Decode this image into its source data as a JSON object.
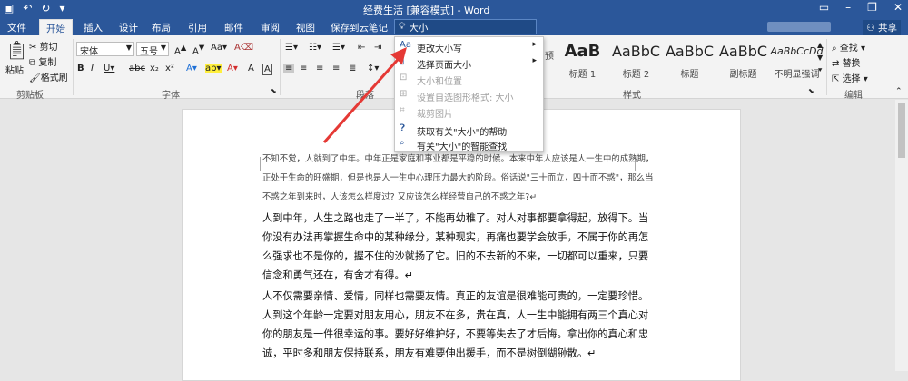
{
  "titlebar": {
    "title": "经费生活 [兼容模式] - Word",
    "share": "共享"
  },
  "tabs": [
    "文件",
    "开始",
    "插入",
    "设计",
    "布局",
    "引用",
    "邮件",
    "审阅",
    "视图",
    "保存到云笔记"
  ],
  "tell_me": {
    "value": "大小"
  },
  "clipboard": {
    "paste": "粘贴",
    "cut": "剪切",
    "copy": "复制",
    "format_painter": "格式刷",
    "label": "剪贴板"
  },
  "font": {
    "name": "宋体",
    "size": "五号",
    "label": "字体",
    "buttons": [
      "A",
      "A",
      "Aa",
      "⬚",
      "B",
      "I",
      "U",
      "abc",
      "x₂",
      "x²",
      "A",
      "ab",
      "A",
      "A"
    ]
  },
  "paragraph": {
    "label": "段落"
  },
  "styles": {
    "items": [
      {
        "preview": "AaB",
        "name": "标题 1"
      },
      {
        "preview": "AaBbC",
        "name": "标题 2"
      },
      {
        "preview": "AaBbC",
        "name": "标题"
      },
      {
        "preview": "AaBbC",
        "name": "副标题"
      },
      {
        "preview": "AaBbCcDd",
        "name": "不明显强调"
      }
    ],
    "label": "样式",
    "partial_label": "预"
  },
  "editing": {
    "find": "查找",
    "replace": "替换",
    "select": "选择",
    "label": "编辑"
  },
  "menu": {
    "items": [
      {
        "label": "更改大小写",
        "disabled": false,
        "submenu": true,
        "icon": "Aa"
      },
      {
        "label": "选择页面大小",
        "disabled": false,
        "submenu": true,
        "icon": "page-size-icon"
      },
      {
        "label": "大小和位置",
        "disabled": true,
        "submenu": false,
        "icon": "size-position-icon"
      },
      {
        "label": "设置自选图形格式: 大小",
        "disabled": true,
        "submenu": false,
        "icon": "format-shape-icon"
      },
      {
        "label": "裁剪图片",
        "disabled": true,
        "submenu": false,
        "icon": "crop-icon"
      },
      {
        "label": "获取有关\"大小\"的帮助",
        "disabled": false,
        "submenu": false,
        "icon": "help-icon"
      },
      {
        "label": "有关\"大小\"的智能查找",
        "disabled": false,
        "submenu": false,
        "icon": "smart-lookup-icon"
      }
    ]
  },
  "document": {
    "p1": "不知不觉，人就到了中年。中年正是家庭和事业都是平稳的时候。本来中年人应该是人一生中的成熟期，正处于生命的旺盛期，但是也是人一生中心理压力最大的阶段。俗话说\"三十而立，四十而不惑\"，那么当不惑之年到来时，人该怎么样度过? 又应该怎么样经营自己的不惑之年?",
    "p2": "人到中年，人生之路也走了一半了，不能再幼稚了。对人对事都要拿得起，放得下。当你没有办法再掌握生命中的某种缘分，某种现实，再痛也要学会放手，不属于你的再怎么强求也不是你的，握不住的沙就扬了它。旧的不去新的不来，一切都可以重来，只要信念和勇气还在，有舍才有得。",
    "p3": "人不仅需要亲情、爱情，同样也需要友情。真正的友谊是很难能可贵的，一定要珍惜。人到这个年龄一定要对朋友用心，朋友不在多，贵在真，人一生中能拥有两三个真心对你的朋友是一件很幸运的事。要好好维护好，不要等失去了才后悔。拿出你的真心和忠诚，平时多和朋友保持联系，朋友有难要伸出援手，而不是树倒猢狲散。",
    "pilcrow": "↵"
  },
  "colors": {
    "brand": "#2b579a",
    "arrow": "#e53935"
  }
}
